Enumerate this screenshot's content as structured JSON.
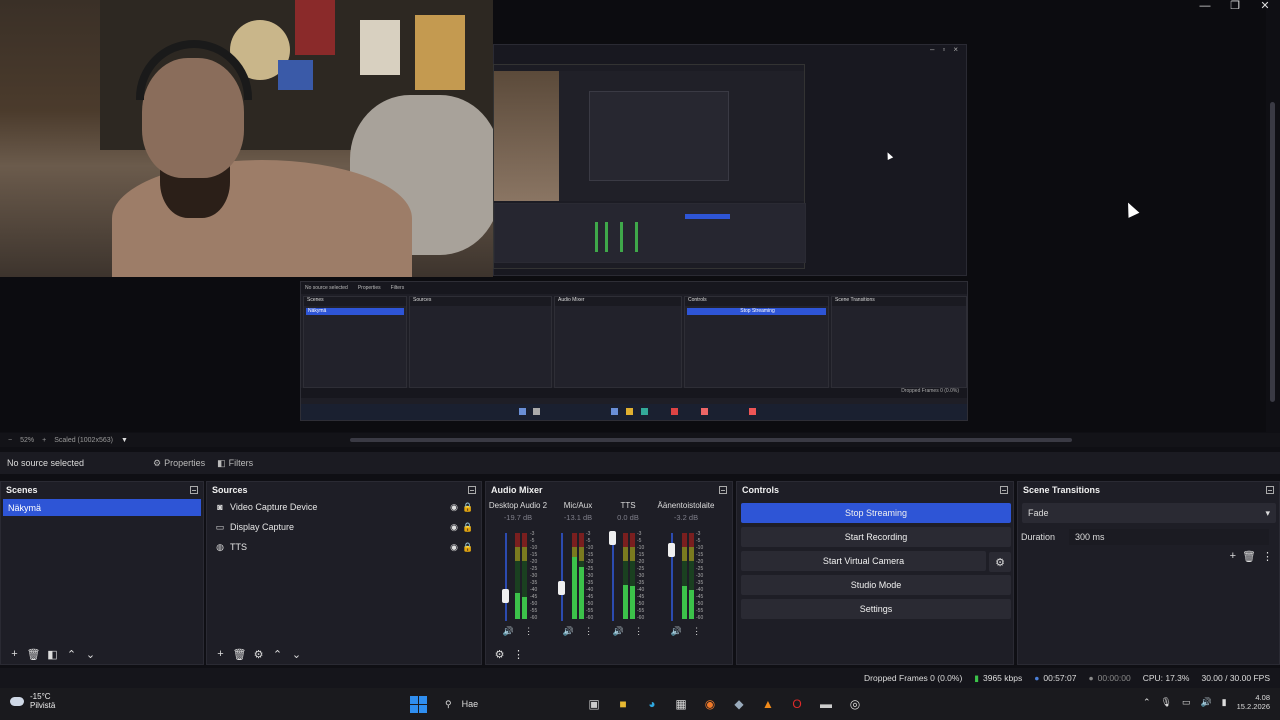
{
  "window_controls": [
    "—",
    "❐",
    "✕"
  ],
  "zoom": {
    "percent": "52%",
    "scale_label": "Scaled (1002x563)"
  },
  "context": {
    "no_source": "No source selected",
    "properties": "Properties",
    "filters": "Filters"
  },
  "scenes": {
    "title": "Scenes",
    "items": [
      "Näkymä"
    ]
  },
  "sources": {
    "title": "Sources",
    "items": [
      {
        "label": "Video Capture Device",
        "icon": "camera-icon"
      },
      {
        "label": "Display Capture",
        "icon": "monitor-icon"
      },
      {
        "label": "TTS",
        "icon": "globe-icon"
      }
    ]
  },
  "mixer": {
    "title": "Audio Mixer",
    "channels": [
      {
        "name": "Desktop Audio 2",
        "db": "-19.7 dB"
      },
      {
        "name": "Mic/Aux",
        "db": "-13.1 dB"
      },
      {
        "name": "TTS",
        "db": "0.0 dB"
      },
      {
        "name": "Äänentoistolaite",
        "db": "-3.2 dB"
      }
    ]
  },
  "controls": {
    "title": "Controls",
    "stop_streaming": "Stop Streaming",
    "start_recording": "Start Recording",
    "start_vcam": "Start Virtual Camera",
    "studio_mode": "Studio Mode",
    "settings": "Settings"
  },
  "transitions": {
    "title": "Scene Transitions",
    "selected": "Fade",
    "duration_label": "Duration",
    "duration_value": "300 ms"
  },
  "status": {
    "dropped": "Dropped Frames 0 (0.0%)",
    "bitrate": "3965 kbps",
    "stream_time": "00:57:07",
    "rec_time": "00:00:00",
    "cpu": "CPU: 17.3%",
    "fps": "30.00 / 30.00 FPS"
  },
  "taskbar": {
    "temp": "-15°C",
    "weather": "Pilvistä",
    "search": "Hae",
    "time": "4.08",
    "date": "15.2.2026"
  },
  "colors": {
    "accent": "#2e55d6",
    "meter_green": "#3cc24a"
  }
}
